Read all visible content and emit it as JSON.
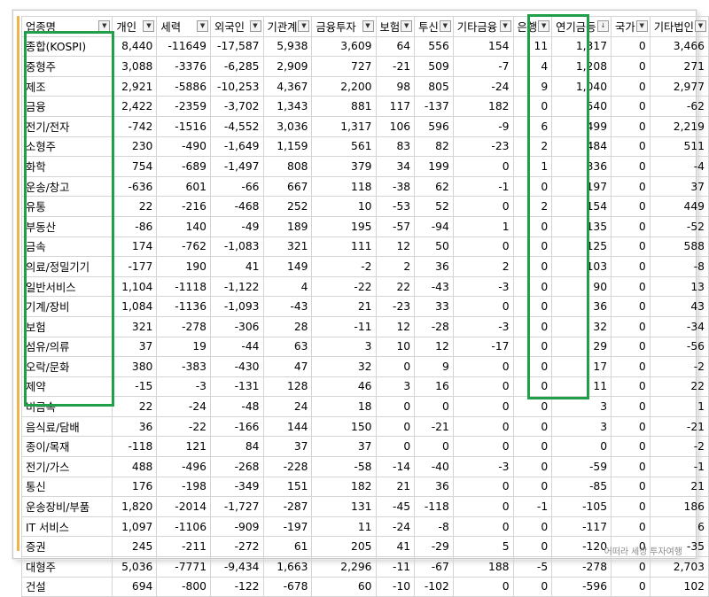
{
  "columns": [
    "업종명",
    "개인",
    "세력",
    "외국인",
    "기관계",
    "금융투자",
    "보험",
    "투신",
    "기타금융",
    "은행",
    "연기금등",
    "국가",
    "기타법인"
  ],
  "rows": [
    [
      "종합(KOSPI)",
      "8,440",
      "-11649",
      "-17,587",
      "5,938",
      "3,609",
      "64",
      "556",
      "154",
      "11",
      "1,317",
      "0",
      "3,466"
    ],
    [
      "중형주",
      "3,088",
      "-3376",
      "-6,285",
      "2,909",
      "727",
      "-21",
      "509",
      "-7",
      "4",
      "1,208",
      "0",
      "271"
    ],
    [
      "제조",
      "2,921",
      "-5886",
      "-10,253",
      "4,367",
      "2,200",
      "98",
      "805",
      "-24",
      "9",
      "1,040",
      "0",
      "2,977"
    ],
    [
      "금융",
      "2,422",
      "-2359",
      "-3,702",
      "1,343",
      "881",
      "117",
      "-137",
      "182",
      "0",
      "540",
      "0",
      "-62"
    ],
    [
      "전기/전자",
      "-742",
      "-1516",
      "-4,552",
      "3,036",
      "1,317",
      "106",
      "596",
      "-9",
      "6",
      "499",
      "0",
      "2,219"
    ],
    [
      "소형주",
      "230",
      "-490",
      "-1,649",
      "1,159",
      "561",
      "83",
      "82",
      "-23",
      "2",
      "484",
      "0",
      "511"
    ],
    [
      "화학",
      "754",
      "-689",
      "-1,497",
      "808",
      "379",
      "34",
      "199",
      "0",
      "1",
      "336",
      "0",
      "-4"
    ],
    [
      "운송/창고",
      "-636",
      "601",
      "-66",
      "667",
      "118",
      "-38",
      "62",
      "-1",
      "0",
      "197",
      "0",
      "37"
    ],
    [
      "유통",
      "22",
      "-216",
      "-468",
      "252",
      "10",
      "-53",
      "52",
      "0",
      "2",
      "154",
      "0",
      "449"
    ],
    [
      "부동산",
      "-86",
      "140",
      "-49",
      "189",
      "195",
      "-57",
      "-94",
      "1",
      "0",
      "135",
      "0",
      "-52"
    ],
    [
      "금속",
      "174",
      "-762",
      "-1,083",
      "321",
      "111",
      "12",
      "50",
      "0",
      "0",
      "125",
      "0",
      "588"
    ],
    [
      "의료/정밀기기",
      "-177",
      "190",
      "41",
      "149",
      "-2",
      "2",
      "36",
      "2",
      "0",
      "103",
      "0",
      "-8"
    ],
    [
      "일반서비스",
      "1,104",
      "-1118",
      "-1,122",
      "4",
      "-22",
      "22",
      "-43",
      "-3",
      "0",
      "90",
      "0",
      "13"
    ],
    [
      "기계/장비",
      "1,084",
      "-1136",
      "-1,093",
      "-43",
      "21",
      "-23",
      "33",
      "0",
      "0",
      "36",
      "0",
      "43"
    ],
    [
      "보험",
      "321",
      "-278",
      "-306",
      "28",
      "-11",
      "12",
      "-28",
      "-3",
      "0",
      "32",
      "0",
      "-34"
    ],
    [
      "섬유/의류",
      "37",
      "19",
      "-44",
      "63",
      "3",
      "10",
      "12",
      "-17",
      "0",
      "29",
      "0",
      "-56"
    ],
    [
      "오락/문화",
      "380",
      "-383",
      "-430",
      "47",
      "32",
      "0",
      "9",
      "0",
      "0",
      "17",
      "0",
      "-2"
    ],
    [
      "제약",
      "-15",
      "-3",
      "-131",
      "128",
      "46",
      "3",
      "16",
      "0",
      "0",
      "11",
      "0",
      "22"
    ],
    [
      "비금속",
      "22",
      "-24",
      "-48",
      "24",
      "18",
      "0",
      "0",
      "0",
      "0",
      "3",
      "0",
      "1"
    ],
    [
      "음식료/담배",
      "36",
      "-22",
      "-166",
      "144",
      "150",
      "0",
      "-21",
      "0",
      "0",
      "3",
      "0",
      "-21"
    ],
    [
      "종이/목재",
      "-118",
      "121",
      "84",
      "37",
      "37",
      "0",
      "0",
      "0",
      "0",
      "0",
      "0",
      "-2"
    ],
    [
      "전기/가스",
      "488",
      "-496",
      "-268",
      "-228",
      "-58",
      "-14",
      "-40",
      "-3",
      "0",
      "-59",
      "0",
      "-1"
    ],
    [
      "통신",
      "176",
      "-198",
      "-349",
      "151",
      "182",
      "21",
      "36",
      "0",
      "0",
      "-85",
      "0",
      "21"
    ],
    [
      "운송장비/부품",
      "1,820",
      "-2014",
      "-1,727",
      "-287",
      "131",
      "-45",
      "-118",
      "0",
      "-1",
      "-105",
      "0",
      "186"
    ],
    [
      "IT 서비스",
      "1,097",
      "-1106",
      "-909",
      "-197",
      "11",
      "-24",
      "-8",
      "0",
      "0",
      "-117",
      "0",
      "6"
    ],
    [
      "증권",
      "245",
      "-211",
      "-272",
      "61",
      "205",
      "41",
      "-29",
      "5",
      "0",
      "-120",
      "0",
      "-35"
    ],
    [
      "대형주",
      "5,036",
      "-7771",
      "-9,434",
      "1,663",
      "2,296",
      "-11",
      "-67",
      "188",
      "-5",
      "-278",
      "0",
      "2,703"
    ],
    [
      "건설",
      "694",
      "-800",
      "-122",
      "-678",
      "60",
      "-10",
      "-102",
      "0",
      "0",
      "-596",
      "0",
      "102"
    ]
  ],
  "sort_indicator_column": "연기금등",
  "colors": {
    "highlight_box": "#1fa048",
    "negative_text": "#ff1a1a",
    "side_accent": "#f0b24a"
  },
  "icons": {
    "filter": "dropdown-filter-icon",
    "sort": "sort-descending-icon"
  },
  "watermark": "어떠라 세상 투자여행"
}
